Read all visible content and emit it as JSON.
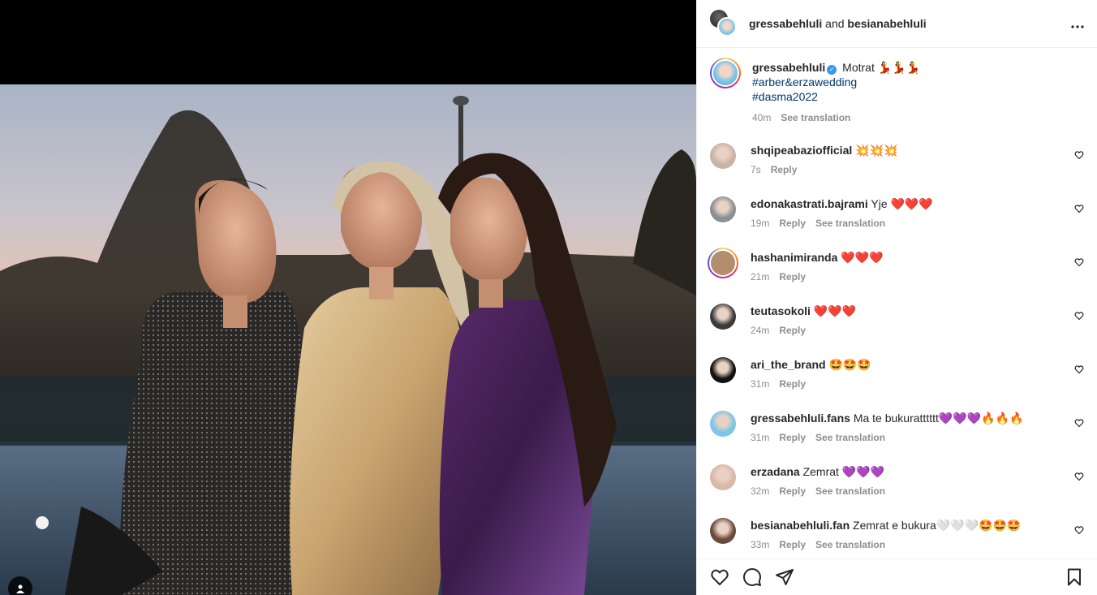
{
  "post": {
    "header": {
      "user1": "gressabehluli",
      "conjunction": "and",
      "user2": "besianabehluli",
      "more_icon": "more-horizontal-icon"
    },
    "caption": {
      "username": "gressabehluli",
      "verified_icon": "verified-badge-icon",
      "text": "Motrat 💃💃💃",
      "hashtags": [
        "#arber&erzawedding",
        "#dasma2022"
      ],
      "time": "40m",
      "see_translation": "See translation"
    },
    "comments": [
      {
        "username": "shqipeabaziofficial",
        "text": "💥💥💥",
        "time": "7s",
        "reply": "Reply",
        "translation": "",
        "avatar": "#c9b3a4",
        "ring": false
      },
      {
        "username": "edonakastrati.bajrami",
        "text": "Yje ❤️❤️❤️",
        "time": "19m",
        "reply": "Reply",
        "translation": "See translation",
        "avatar": "#8a8f96",
        "ring": false
      },
      {
        "username": "hashanimiranda",
        "text": "❤️❤️❤️",
        "time": "21m",
        "reply": "Reply",
        "translation": "",
        "avatar": "#b48d6e",
        "ring": true
      },
      {
        "username": "teutasokoli",
        "text": "❤️❤️❤️",
        "time": "24m",
        "reply": "Reply",
        "translation": "",
        "avatar": "#3a3a3a",
        "ring": false
      },
      {
        "username": "ari_the_brand",
        "text": "🤩🤩🤩",
        "time": "31m",
        "reply": "Reply",
        "translation": "",
        "avatar": "#111111",
        "ring": false
      },
      {
        "username": "gressabehluli.fans",
        "text": "Ma te bukuratttttt💜💜💜🔥🔥🔥",
        "time": "31m",
        "reply": "Reply",
        "translation": "See translation",
        "avatar": "#7cc6e8",
        "ring": false
      },
      {
        "username": "erzadana",
        "text": "Zemrat 💜💜💜",
        "time": "32m",
        "reply": "Reply",
        "translation": "See translation",
        "avatar": "#d8b8a8",
        "ring": false
      },
      {
        "username": "besianabehluli.fan",
        "text": "Zemrat e bukura🤍🤍🤍🤩🤩🤩",
        "time": "33m",
        "reply": "Reply",
        "translation": "See translation",
        "avatar": "#6b4a3a",
        "ring": false
      }
    ],
    "actions": {
      "like_icon": "heart-icon",
      "comment_icon": "comment-icon",
      "share_icon": "share-icon",
      "save_icon": "bookmark-icon"
    },
    "media": {
      "description_icon": "user-tag-icon"
    }
  }
}
